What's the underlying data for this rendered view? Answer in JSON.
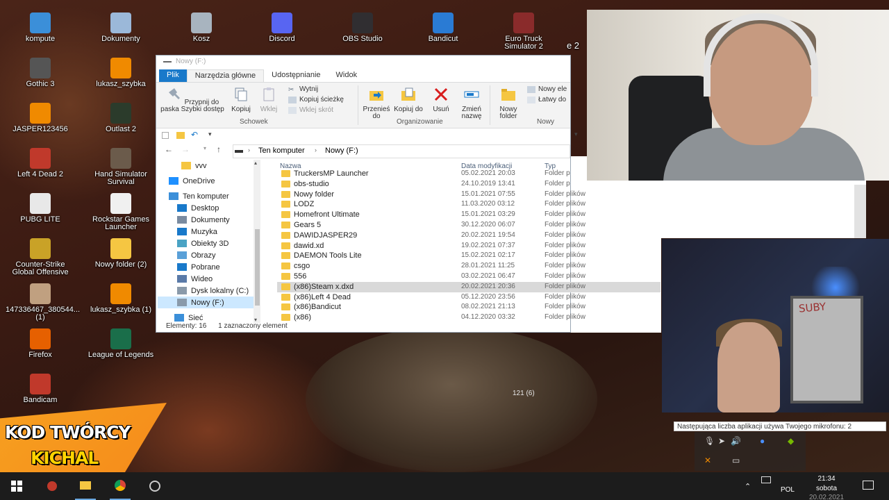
{
  "desktop": {
    "icons": [
      {
        "label": "kompute",
        "icon": "computer-icon",
        "color": "#3b8fd9"
      },
      {
        "label": "Dokumenty",
        "icon": "documents-icon",
        "color": "#9bb8d9"
      },
      {
        "label": "Kosz",
        "icon": "recycle-bin-icon",
        "color": "#a8b4bf"
      },
      {
        "label": "Discord",
        "icon": "discord-icon",
        "color": "#5865f2"
      },
      {
        "label": "OBS Studio",
        "icon": "obs-icon",
        "color": "#302e31"
      },
      {
        "label": "Bandicut",
        "icon": "bandicut-icon",
        "color": "#2a7bd4"
      },
      {
        "label": "Euro Truck Simulator 2",
        "icon": "truck-icon",
        "color": "#8a2b2b"
      },
      {
        "label": "Gothic 3",
        "icon": "gothic-icon",
        "color": "#555555"
      },
      {
        "label": "lukasz_szybka",
        "icon": "vlc-icon",
        "color": "#f08a00"
      },
      {
        "label": "JASPER123456",
        "icon": "vlc-icon",
        "color": "#f08a00"
      },
      {
        "label": "Outlast 2",
        "icon": "outlast-icon",
        "color": "#2b3b2b"
      },
      {
        "label": "Left 4 Dead 2",
        "icon": "l4d2-icon",
        "color": "#c0392b"
      },
      {
        "label": "Hand Simulator Survival",
        "icon": "hand-sim-icon",
        "color": "#6b5b4b"
      },
      {
        "label": "PUBG LITE",
        "icon": "pubg-icon",
        "color": "#e8e8e8"
      },
      {
        "label": "Rockstar Games Launcher",
        "icon": "rockstar-icon",
        "color": "#f0f0f0"
      },
      {
        "label": "Counter-Strike Global Offensive",
        "icon": "csgo-icon",
        "color": "#c9a227"
      },
      {
        "label": "Nowy folder (2)",
        "icon": "folder-icon",
        "color": "#f5c642"
      },
      {
        "label": "147336467_380544... (1)",
        "icon": "image-icon",
        "color": "#c0a080"
      },
      {
        "label": "lukasz_szybka (1)",
        "icon": "vlc-icon",
        "color": "#f08a00"
      },
      {
        "label": "Firefox",
        "icon": "firefox-icon",
        "color": "#e66000"
      },
      {
        "label": "League of Legends",
        "icon": "lol-icon",
        "color": "#1a6e4a"
      },
      {
        "label": "Bandicam",
        "icon": "bandicam-icon",
        "color": "#c0392b"
      }
    ],
    "partial_label": "e 2",
    "dog_counter": "121 (6)"
  },
  "explorer": {
    "title": "Nowy (F:)",
    "tabs": [
      "Plik",
      "Narzędzia główne",
      "Udostępnianie",
      "Widok"
    ],
    "ribbon": {
      "pin": "Przypnij do paska Szybki dostęp",
      "copy": "Kopiuj",
      "paste": "Wklej",
      "cut": "Wytnij",
      "copy_path": "Kopiuj ścieżkę",
      "paste_shortcut": "Wklej skrót",
      "clipboard_group": "Schowek",
      "move_to": "Przenieś do",
      "copy_to": "Kopiuj do",
      "delete": "Usuń",
      "rename": "Zmień nazwę",
      "organize_group": "Organizowanie",
      "new_folder": "Nowy folder",
      "new_item": "Nowy ele",
      "easy_access": "Łatwy do",
      "new_group": "Nowy"
    },
    "address": {
      "root": "Ten komputer",
      "drive": "Nowy (F:)"
    },
    "nav": [
      {
        "label": "vvv",
        "icon": "folder-icon"
      },
      {
        "label": "OneDrive",
        "icon": "onedrive-icon"
      },
      {
        "label": "Ten komputer",
        "icon": "computer-icon"
      },
      {
        "label": "Desktop",
        "icon": "desktop-icon"
      },
      {
        "label": "Dokumenty",
        "icon": "documents-icon"
      },
      {
        "label": "Muzyka",
        "icon": "music-icon"
      },
      {
        "label": "Obiekty 3D",
        "icon": "cube-icon"
      },
      {
        "label": "Obrazy",
        "icon": "pictures-icon"
      },
      {
        "label": "Pobrane",
        "icon": "download-icon"
      },
      {
        "label": "Wideo",
        "icon": "video-icon"
      },
      {
        "label": "Dysk lokalny (C:)",
        "icon": "drive-icon"
      },
      {
        "label": "Nowy (F:)",
        "icon": "drive-icon"
      },
      {
        "label": "Sieć",
        "icon": "network-icon"
      }
    ],
    "columns": {
      "name": "Nazwa",
      "date": "Data modyfikacji",
      "type": "Typ"
    },
    "files": [
      {
        "name": "TruckersMP Launcher",
        "date": "05.02.2021 20:03",
        "type": "Folder p"
      },
      {
        "name": "obs-studio",
        "date": "24.10.2019 13:41",
        "type": "Folder p"
      },
      {
        "name": "Nowy folder",
        "date": "15.01.2021 07:55",
        "type": "Folder plików"
      },
      {
        "name": "LODZ",
        "date": "11.03.2020 03:12",
        "type": "Folder plików"
      },
      {
        "name": "Homefront Ultimate",
        "date": "15.01.2021 03:29",
        "type": "Folder plików"
      },
      {
        "name": "Gears 5",
        "date": "30.12.2020 06:07",
        "type": "Folder plików"
      },
      {
        "name": "DAWIDJASPER29",
        "date": "20.02.2021 19:54",
        "type": "Folder plików"
      },
      {
        "name": "dawid.xd",
        "date": "19.02.2021 07:37",
        "type": "Folder plików"
      },
      {
        "name": "DAEMON Tools Lite",
        "date": "15.02.2021 02:17",
        "type": "Folder plików"
      },
      {
        "name": "csgo",
        "date": "28.01.2021 11:25",
        "type": "Folder plików"
      },
      {
        "name": "556",
        "date": "03.02.2021 06:47",
        "type": "Folder plików"
      },
      {
        "name": "(x86)Steam x.dxd",
        "date": "20.02.2021 20:36",
        "type": "Folder plików"
      },
      {
        "name": "(x86)Left 4 Dead",
        "date": "05.12.2020 23:56",
        "type": "Folder plików"
      },
      {
        "name": "(x86)Bandicut",
        "date": "08.02.2021 21:13",
        "type": "Folder plików"
      },
      {
        "name": "(x86)",
        "date": "04.12.2020 03:32",
        "type": "Folder plików"
      }
    ],
    "status": {
      "count": "Elementy: 16",
      "selected": "1 zaznaczony element"
    }
  },
  "webcam2": {
    "board_text": "SUBY"
  },
  "notification": "Następująca liczba aplikacji używa Twojego mikrofonu: 2",
  "promo": {
    "line1": "KOD TWÓRCY",
    "line2": "KICHAL"
  },
  "taskbar": {
    "language": "POL",
    "time": "21:34",
    "day": "sobota",
    "date": "20.02.2021"
  }
}
